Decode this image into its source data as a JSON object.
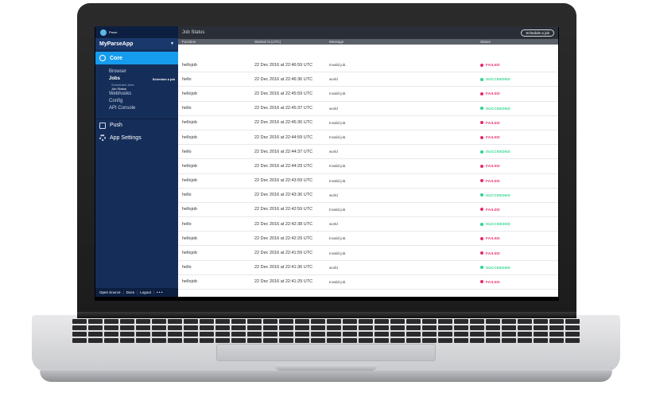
{
  "app": {
    "logo_text": "Parse",
    "app_name": "MyParseApp"
  },
  "sidebar": {
    "core_label": "Core",
    "items": [
      "Browser",
      "Jobs",
      "Webhooks",
      "Config",
      "API Console"
    ],
    "schedule_link": "Schedule a job",
    "jobs_subitems": [
      "Scheduled Jobs",
      "Job Status"
    ],
    "push_label": "Push",
    "settings_label": "App Settings",
    "footer": [
      "Open Source",
      "Docs",
      "Logout",
      "• • •"
    ]
  },
  "header": {
    "title": "Job Status",
    "schedule_button": "Schedule a job"
  },
  "table": {
    "columns": [
      "Function",
      "Started At (UTC)",
      "Message",
      "Status"
    ],
    "rows": [
      {
        "function": "hellojob",
        "started": "22 Dec 2016 at 22:46:59 UTC",
        "message": "Invalid job.",
        "status": "FAILED"
      },
      {
        "function": "hello",
        "started": "22 Dec 2016 at 22:46:36 UTC",
        "message": "world",
        "status": "SUCCEEDED"
      },
      {
        "function": "hellojob",
        "started": "22 Dec 2016 at 22:45:59 UTC",
        "message": "Invalid job.",
        "status": "FAILED"
      },
      {
        "function": "hello",
        "started": "22 Dec 2016 at 22:45:37 UTC",
        "message": "world",
        "status": "SUCCEEDED"
      },
      {
        "function": "hellojob",
        "started": "22 Dec 2016 at 22:45:30 UTC",
        "message": "Invalid job.",
        "status": "FAILED"
      },
      {
        "function": "hellojob",
        "started": "22 Dec 2016 at 22:44:59 UTC",
        "message": "Invalid job.",
        "status": "FAILED"
      },
      {
        "function": "hello",
        "started": "22 Dec 2016 at 22:44:37 UTC",
        "message": "world",
        "status": "SUCCEEDED"
      },
      {
        "function": "hellojob",
        "started": "22 Dec 2016 at 22:44:29 UTC",
        "message": "Invalid job.",
        "status": "FAILED"
      },
      {
        "function": "hellojob",
        "started": "22 Dec 2016 at 22:43:59 UTC",
        "message": "Invalid job.",
        "status": "FAILED"
      },
      {
        "function": "hello",
        "started": "22 Dec 2016 at 22:43:36 UTC",
        "message": "world",
        "status": "SUCCEEDED"
      },
      {
        "function": "hellojob",
        "started": "22 Dec 2016 at 22:42:59 UTC",
        "message": "Invalid job.",
        "status": "FAILED"
      },
      {
        "function": "hello",
        "started": "22 Dec 2016 at 22:42:38 UTC",
        "message": "world",
        "status": "SUCCEEDED"
      },
      {
        "function": "hellojob",
        "started": "22 Dec 2016 at 22:42:29 UTC",
        "message": "Invalid job.",
        "status": "FAILED"
      },
      {
        "function": "hellojob",
        "started": "22 Dec 2016 at 22:41:59 UTC",
        "message": "Invalid job.",
        "status": "FAILED"
      },
      {
        "function": "hello",
        "started": "22 Dec 2016 at 22:41:36 UTC",
        "message": "world",
        "status": "SUCCEEDED"
      },
      {
        "function": "hellojob",
        "started": "22 Dec 2016 at 22:41:29 UTC",
        "message": "Invalid job.",
        "status": "FAILED"
      }
    ]
  },
  "colors": {
    "failed": "#e8276e",
    "succeeded": "#2bd58c",
    "accent": "#169cee",
    "sidebar": "#152e59"
  }
}
